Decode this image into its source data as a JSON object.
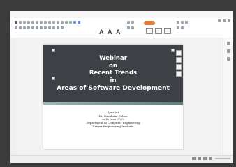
{
  "slide": {
    "title_lines": [
      "Webinar",
      "on",
      "Recent Trends",
      "in",
      "Areas of Software Development"
    ],
    "details": [
      "Speaker",
      "Dr. Mandrani Cohen",
      "ss-th June 2022",
      "Department of Computer Engineering",
      "Xxxxxx Engineering Institute"
    ]
  },
  "colors": {
    "slide_header": "#3d4045",
    "accent_tab": "#e07a3a",
    "stripe_start": "#9fb5b2",
    "stripe_end": "#5e7f7c"
  },
  "icons": [
    "font-grow-icon",
    "font-shrink-icon",
    "clear-format-icon",
    "layout-icon",
    "zoom-slider-icon"
  ]
}
